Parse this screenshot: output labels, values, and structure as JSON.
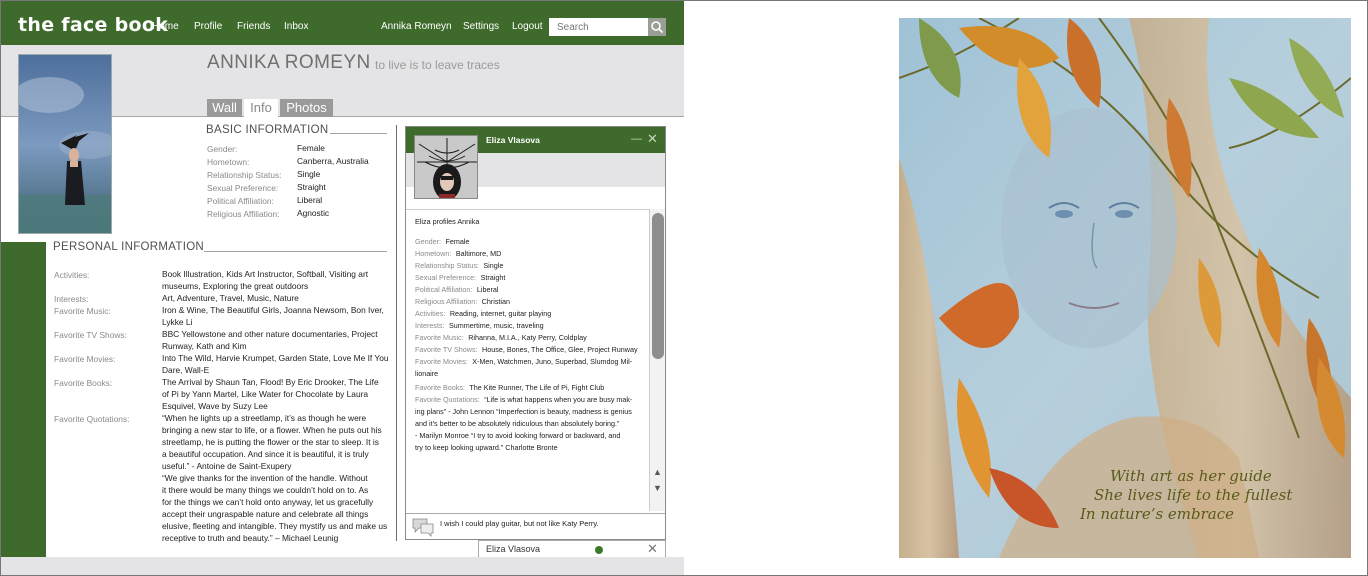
{
  "app": {
    "logo": "the face book",
    "nav": [
      "Home",
      "Profile",
      "Friends",
      "Inbox"
    ],
    "user_nav": [
      "Annika Romeyn",
      "Settings",
      "Logout"
    ],
    "search_placeholder": "Search"
  },
  "colors": {
    "brand_green": "#3e6b2b",
    "header_grey": "#e4e4e6"
  },
  "profile": {
    "name": "ANNIKA ROMEYN",
    "motto": "to live is to leave traces",
    "tabs": [
      "Wall",
      "Info",
      "Photos"
    ],
    "active_tab": "Info"
  },
  "basic": {
    "title": "BASIC INFORMATION",
    "rows": [
      {
        "label": "Gender:",
        "value": "Female"
      },
      {
        "label": "Hometown:",
        "value": "Canberra, Australia"
      },
      {
        "label": "Relationship Status:",
        "value": "Single"
      },
      {
        "label": "Sexual Preference:",
        "value": "Straight"
      },
      {
        "label": "Political Affiliation:",
        "value": "Liberal"
      },
      {
        "label": "Religious Affiliation:",
        "value": "Agnostic"
      }
    ]
  },
  "personal": {
    "title": "PERSONAL INFORMATION",
    "rows": [
      {
        "label": "Activities:",
        "lines": [
          "Book Illustration, Kids Art Instructor, Softball, Visiting art",
          "museums, Exploring the great outdoors"
        ]
      },
      {
        "label": "Interests:",
        "lines": [
          "Art, Adventure, Travel, Music, Nature"
        ]
      },
      {
        "label": "Favorite Music:",
        "lines": [
          "Iron & Wine, The Beautiful Girls, Joanna Newsom, Bon Iver,",
          "Lykke Li"
        ]
      },
      {
        "label": "Favorite TV Shows:",
        "lines": [
          "BBC Yellowstone and other nature documentaries, Project",
          "Runway, Kath and Kim"
        ]
      },
      {
        "label": "Favorite Movies:",
        "lines": [
          "Into The Wild, Harvie Krumpet, Garden State, Love Me If You",
          "Dare, Wall-E"
        ]
      },
      {
        "label": "Favorite Books:",
        "lines": [
          "The Arrival by Shaun Tan, Flood! By Eric Drooker, The Life",
          "of Pi by Yann Martel, Like Water for Chocolate by Laura",
          "Esquivel, Wave by Suzy Lee"
        ]
      },
      {
        "label": "Favorite Quotations:",
        "lines": [
          "“When he lights up a streetlamp, it’s as though he were",
          "bringing a new star to life, or a flower. When he puts out his",
          "streetlamp, he is putting the flower or the star to sleep. It is",
          "a beautiful occupation. And since it is beautiful, it is truly",
          "useful.” - Antoine de Saint-Exupery",
          "“We give thanks for the invention of the handle. Without",
          "it there would be many things we couldn’t hold on to. As",
          "for the things we can’t hold onto anyway, let us gracefully",
          "accept their ungraspable nature and celebrate all things",
          "elusive, fleeting and intangible. They mystify us and make us",
          "receptive to truth and beauty.” – Michael Leunig"
        ]
      }
    ]
  },
  "chat": {
    "title": "Eliza Vlasova",
    "intro": "Eliza profiles Annika",
    "rows": [
      {
        "label": "Gender:",
        "value": "Female"
      },
      {
        "label": "Hometown:",
        "value": "Baltimore, MD"
      },
      {
        "label": "Relationship Status:",
        "value": "Single"
      },
      {
        "label": "Sexual Preference:",
        "value": "Straight"
      },
      {
        "label": "Political Affiliation:",
        "value": "Liberal"
      },
      {
        "label": "Religious Affiliation:",
        "value": "Christian"
      },
      {
        "label": "Activities:",
        "value": "Reading, internet, guitar playing"
      },
      {
        "label": "Interests:",
        "value": "Summertime, music, traveling"
      },
      {
        "label": "Favorite Music:",
        "value": "Rihanna, M.I.A., Katy Perry, Coldplay"
      },
      {
        "label": "Favorite TV Shows:",
        "value": "House, Bones, The Office, Glee, Project Runway"
      },
      {
        "label": "Favorite Movies:",
        "value": "X-Men, Watchmen, Juno, Superbad, Slumdog Mil-"
      },
      {
        "label": "",
        "value": "lionaire"
      },
      {
        "label": "Favorite Books:",
        "value": "The Kite Runner, The Life of Pi, Fight Club"
      },
      {
        "label": "Favorite Quotations:",
        "value": "  “Life is what happens when you are busy mak-"
      },
      {
        "label": "",
        "value": "ing plans” - John Lennon “Imperfection is beauty, madness is genius"
      },
      {
        "label": "",
        "value": "and it’s better to be absolutely ridiculous than absolutely boring.”"
      },
      {
        "label": "",
        "value": "- Marilyn Monroe “I try to avoid looking forward or backward, and"
      },
      {
        "label": "",
        "value": "try to keep looking upward.” Charlotte Bronte"
      }
    ],
    "message": "I wish I could play guitar, but not like Katy Perry.",
    "tab_name": "Eliza Vlasova"
  },
  "artwork": {
    "caption": [
      "With art as her guide",
      "She lives life to the fullest",
      "In nature’s embrace"
    ]
  }
}
